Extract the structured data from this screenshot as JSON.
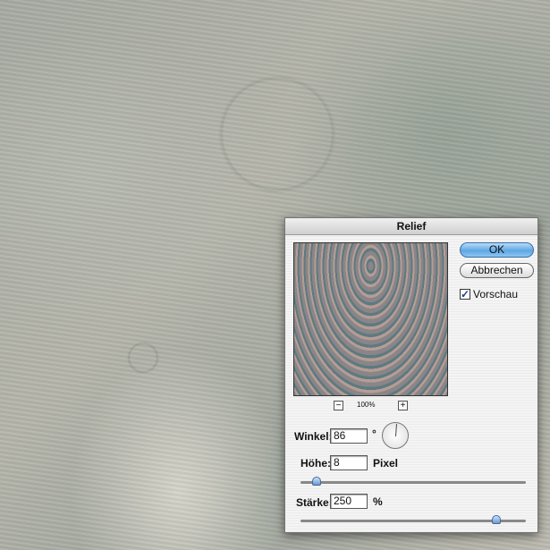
{
  "dialog": {
    "title": "Relief",
    "ok": "OK",
    "cancel": "Abbrechen",
    "preview_label": "Vorschau",
    "preview_checked": true,
    "zoom": {
      "minus": "−",
      "plus": "+",
      "value": "100%"
    },
    "angle": {
      "label": "Winkel:",
      "value": "86",
      "unit": "°"
    },
    "height": {
      "label": "Höhe:",
      "value": "8",
      "unit": "Pixel",
      "slider_fraction": 0.07
    },
    "amount": {
      "label": "Stärke:",
      "value": "250",
      "unit": "%",
      "slider_fraction": 0.87
    }
  }
}
